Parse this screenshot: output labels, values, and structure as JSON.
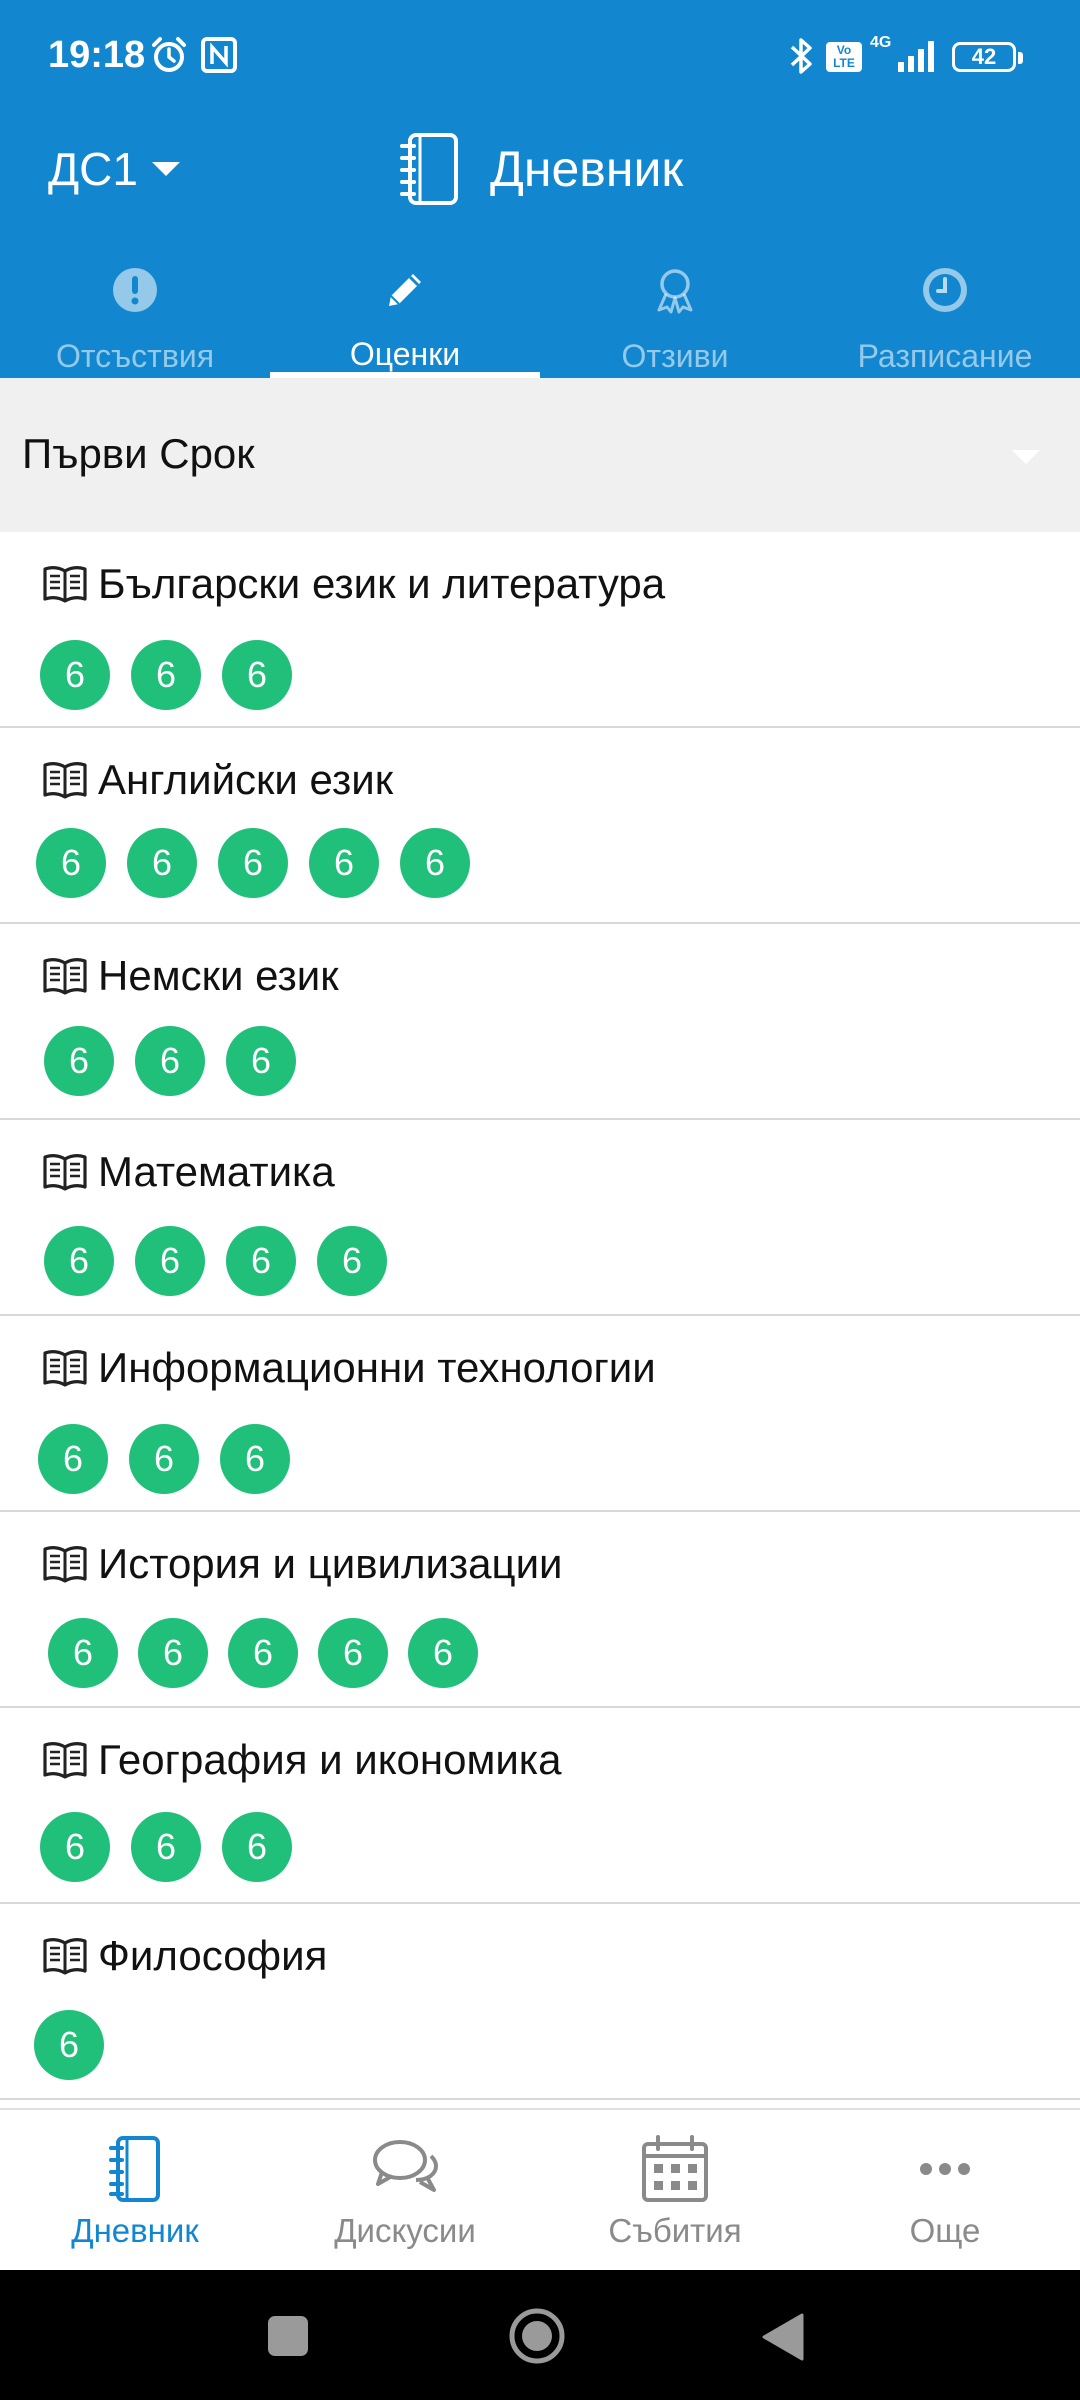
{
  "status_bar": {
    "time": "19:18",
    "network": "4G",
    "volte": "Vo LTE",
    "battery": "42"
  },
  "header": {
    "class_label": "ДС1",
    "title": "Дневник"
  },
  "tabs": [
    {
      "label": "Отсъствия",
      "icon": "exclamation-icon",
      "active": false
    },
    {
      "label": "Оценки",
      "icon": "pencil-icon",
      "active": true
    },
    {
      "label": "Отзиви",
      "icon": "ribbon-award-icon",
      "active": false
    },
    {
      "label": "Разписание",
      "icon": "clock-icon",
      "active": false
    }
  ],
  "term": {
    "label": "Първи Срок"
  },
  "subjects": [
    {
      "name": "Български език и литература",
      "grades": [
        "6",
        "6",
        "6"
      ]
    },
    {
      "name": "Английски език",
      "grades": [
        "6",
        "6",
        "6",
        "6",
        "6"
      ]
    },
    {
      "name": "Немски език",
      "grades": [
        "6",
        "6",
        "6"
      ]
    },
    {
      "name": "Математика",
      "grades": [
        "6",
        "6",
        "6",
        "6"
      ]
    },
    {
      "name": "Информационни технологии",
      "grades": [
        "6",
        "6",
        "6"
      ]
    },
    {
      "name": "История и цивилизации",
      "grades": [
        "6",
        "6",
        "6",
        "6",
        "6"
      ]
    },
    {
      "name": "География и икономика",
      "grades": [
        "6",
        "6",
        "6"
      ]
    },
    {
      "name": "Философия",
      "grades": [
        "6"
      ]
    }
  ],
  "bottom_nav": [
    {
      "label": "Дневник",
      "icon": "notebook-icon",
      "active": true
    },
    {
      "label": "Дискусии",
      "icon": "chat-bubbles-icon",
      "active": false
    },
    {
      "label": "Събития",
      "icon": "calendar-icon",
      "active": false
    },
    {
      "label": "Още",
      "icon": "more-dots-icon",
      "active": false
    }
  ],
  "colors": {
    "primary": "#1287d0",
    "grade": "#21c07a",
    "term_bar": "#f0f0f0",
    "inactive_nav": "#8a8a8a"
  }
}
